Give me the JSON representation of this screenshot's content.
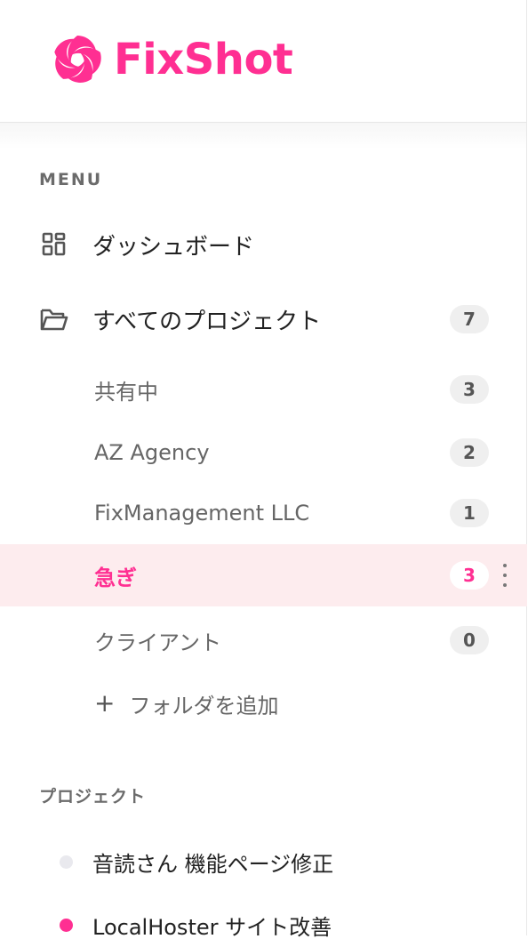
{
  "brand": {
    "name": "FixShot",
    "color": "#ff2f92"
  },
  "menu": {
    "section_label": "MENU",
    "dashboard": {
      "label": "ダッシュボード",
      "icon": "grid-icon"
    },
    "all_projects": {
      "label": "すべてのプロジェクト",
      "icon": "folder-icon",
      "count": "7"
    },
    "folders": [
      {
        "label": "共有中",
        "count": "3"
      },
      {
        "label": "AZ Agency",
        "count": "2"
      },
      {
        "label": "FixManagement LLC",
        "count": "1"
      },
      {
        "label": "急ぎ",
        "count": "3",
        "active": true
      },
      {
        "label": "クライアント",
        "count": "0"
      }
    ],
    "add_folder": {
      "icon": "+",
      "label": "フォルダを追加"
    }
  },
  "projects": {
    "section_label": "プロジェクト",
    "items": [
      {
        "label": "音読さん 機能ページ修正",
        "dot_color": "#e9e9ee"
      },
      {
        "label": "LocalHoster サイト改善",
        "dot_color": "#ff2f92"
      }
    ]
  },
  "colors": {
    "accent": "#ff2f92",
    "active_bg": "#fdecee",
    "badge_bg": "#efefef"
  }
}
